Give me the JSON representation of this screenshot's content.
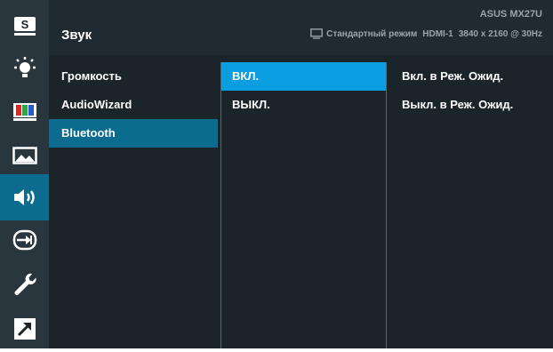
{
  "sidebar": {
    "items": [
      {
        "icon": "splendid-icon",
        "label": "S"
      },
      {
        "icon": "brightness-icon"
      },
      {
        "icon": "color-icon"
      },
      {
        "icon": "image-icon"
      },
      {
        "icon": "sound-icon",
        "active": true
      },
      {
        "icon": "input-select-icon"
      },
      {
        "icon": "system-setup-icon"
      },
      {
        "icon": "shortcut-icon"
      }
    ]
  },
  "header": {
    "title": "Звук",
    "model": "ASUS MX27U",
    "mode": "Стандартный режим",
    "input": "HDMI-1",
    "resolution": "3840 x 2160 @ 30Hz"
  },
  "menu": {
    "items": [
      {
        "label": "Громкость"
      },
      {
        "label": "AudioWizard"
      },
      {
        "label": "Bluetooth",
        "selected": true
      }
    ]
  },
  "submenu": {
    "items": [
      {
        "label": "ВКЛ.",
        "selected": true
      },
      {
        "label": "ВЫКЛ."
      }
    ]
  },
  "options": {
    "items": [
      {
        "label": "Вкл. в Реж. Ожид."
      },
      {
        "label": "Выкл. в Реж. Ожид."
      }
    ]
  },
  "colors": {
    "background": "#1b2429",
    "sidebar": "#2a363d",
    "active_blue": "#0c6c90",
    "highlight_blue": "#0a9ee0"
  }
}
